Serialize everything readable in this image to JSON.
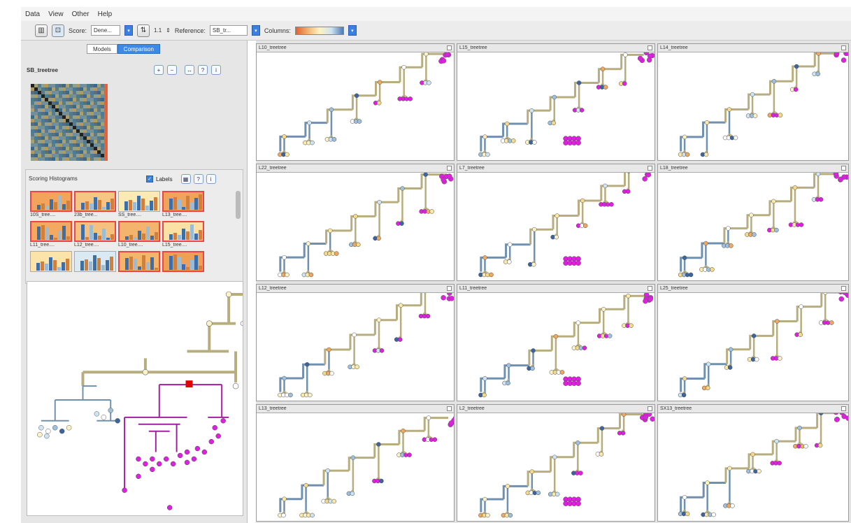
{
  "menu": [
    "Data",
    "View",
    "Other",
    "Help"
  ],
  "toolbar": {
    "icon1": "chart-icon",
    "icon2": "layout-icon",
    "score_label": "Score:",
    "score_value": "Dene...",
    "icon3": "sort-icon",
    "ratio_value": "1.1",
    "reference_label": "Reference:",
    "reference_value": "SB_tr...",
    "columns_label": "Columns:"
  },
  "left": {
    "tabs": [
      "Models",
      "Comparison"
    ],
    "active_tab": "Comparison",
    "matrix_title": "SB_treetree",
    "matrix_tools": [
      "zoom-in-icon",
      "zoom-out-icon",
      "expand-icon",
      "help-icon",
      "info-icon"
    ],
    "hist_title": "Scoring Histograms",
    "labels_checkbox": "Labels",
    "labels_checked": true,
    "hist_tools": [
      "grid-icon",
      "help-icon",
      "info-icon"
    ],
    "histograms": [
      {
        "label": "10S_tree....",
        "color": "#f2a45c",
        "border": "red"
      },
      {
        "label": "23b_tree...",
        "color": "#f6c583",
        "border": "red"
      },
      {
        "label": "SS_tree....",
        "color": "#fbeab1",
        "border": "plain"
      },
      {
        "label": "L13_tree....",
        "color": "#f0a35a",
        "border": "red"
      },
      {
        "label": "L11_tree....",
        "color": "#f3aa60",
        "border": "red"
      },
      {
        "label": "L12_tree....",
        "color": "#f6c07e",
        "border": "red"
      },
      {
        "label": "L10_tree....",
        "color": "#f4b46e",
        "border": "red"
      },
      {
        "label": "L15_tree....",
        "color": "#fbe1a4",
        "border": "red"
      },
      {
        "label": "",
        "color": "#fbe3a9",
        "border": "plain"
      },
      {
        "label": "",
        "color": "#d9eaf5",
        "border": "plain"
      },
      {
        "label": "",
        "color": "#f5b56c",
        "border": "red"
      },
      {
        "label": "",
        "color": "#f0a055",
        "border": "red"
      }
    ]
  },
  "panels": [
    {
      "title": "L10_treetree"
    },
    {
      "title": "L15_treetree"
    },
    {
      "title": "L14_treetree"
    },
    {
      "title": "L22_treetree"
    },
    {
      "title": "L7_treetree"
    },
    {
      "title": "L18_treetree"
    },
    {
      "title": "L12_treetree"
    },
    {
      "title": "L11_treetree"
    },
    {
      "title": "L25_treetree"
    },
    {
      "title": "L13_treetree"
    },
    {
      "title": "L2_treetree"
    },
    {
      "title": "SX13_treetree"
    }
  ],
  "colors": {
    "accent": "#3d8ae6",
    "leaf_magenta": "#e020e0",
    "branch_tan": "#b8ad7e",
    "branch_blue": "#7090b0",
    "selection_red": "#e00000"
  }
}
